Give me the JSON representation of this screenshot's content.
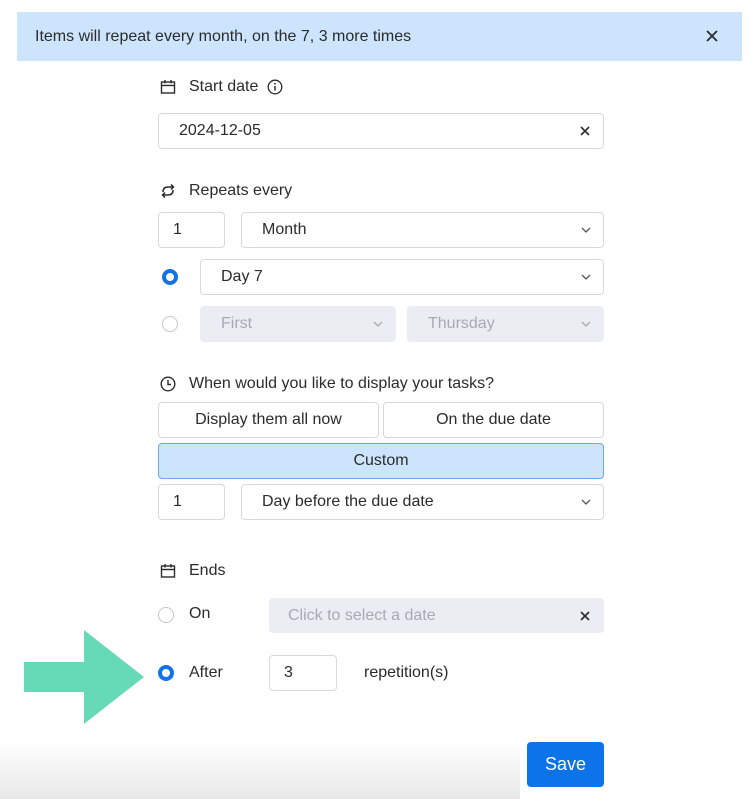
{
  "banner": {
    "text": "Items will repeat every month, on the 7, 3 more times",
    "close_icon": "close-icon"
  },
  "start_date": {
    "label": "Start date",
    "icon": "calendar-icon",
    "info_icon": "info-icon",
    "value": "2024-12-05",
    "clear_icon": "close-icon"
  },
  "repeats": {
    "label": "Repeats every",
    "icon": "repeat-icon",
    "interval_value": "1",
    "unit_value": "Month",
    "option_day": {
      "selected": true,
      "value": "Day 7"
    },
    "option_weekday": {
      "selected": false,
      "ordinal_value": "First",
      "weekday_value": "Thursday"
    }
  },
  "display": {
    "label": "When would you like to display your tasks?",
    "icon": "clock-icon",
    "buttons": [
      {
        "label": "Display them all now",
        "active": false
      },
      {
        "label": "On the due date",
        "active": false
      },
      {
        "label": "Custom",
        "active": true
      }
    ],
    "custom_value": "1",
    "custom_unit": "Day before the due date"
  },
  "ends": {
    "label": "Ends",
    "icon": "calendar-icon",
    "on": {
      "label": "On",
      "selected": false,
      "placeholder": "Click to select a date"
    },
    "after": {
      "label": "After",
      "selected": true,
      "value": "3",
      "suffix": "repetition(s)"
    }
  },
  "footer": {
    "save_label": "Save"
  },
  "annotation": {
    "arrow_color": "#66dab6"
  },
  "colors": {
    "accent": "#0d73e8",
    "banner_bg": "#cce4fc",
    "disabled_bg": "#ececf3"
  }
}
